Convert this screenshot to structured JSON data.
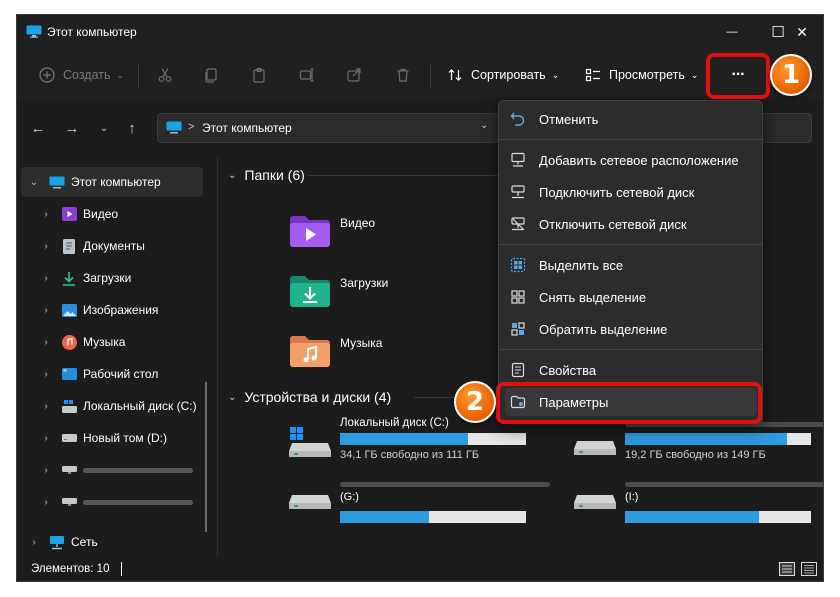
{
  "window": {
    "title": "Этот компьютер",
    "minimize_glyph": "—",
    "maximize_glyph": "☐",
    "close_glyph": "✕"
  },
  "toolbar": {
    "create_label": "Создать",
    "sort_label": "Сортировать",
    "view_label": "Просмотреть",
    "more_label": "···"
  },
  "address": {
    "path": "Этот компьютер",
    "separator": ">"
  },
  "sidebar": {
    "items": [
      {
        "label": "Этот компьютер",
        "icon": "monitor-icon"
      },
      {
        "label": "Видео",
        "icon": "video-folder-icon"
      },
      {
        "label": "Документы",
        "icon": "documents-icon"
      },
      {
        "label": "Загрузки",
        "icon": "downloads-icon"
      },
      {
        "label": "Изображения",
        "icon": "pictures-icon"
      },
      {
        "label": "Музыка",
        "icon": "music-icon"
      },
      {
        "label": "Рабочий стол",
        "icon": "desktop-icon"
      },
      {
        "label": "Локальный диск (C:)",
        "icon": "windows-drive-icon"
      },
      {
        "label": "Новый том (D:)",
        "icon": "drive-icon"
      },
      {
        "label": "",
        "icon": "network-drive-icon"
      },
      {
        "label": "",
        "icon": "network-drive-icon"
      },
      {
        "label": "Сеть",
        "icon": "network-icon"
      }
    ]
  },
  "content": {
    "folders_header": "Папки (6)",
    "folders": [
      {
        "label": "Видео",
        "icon": "video-folder-icon"
      },
      {
        "label": "Загрузки",
        "icon": "downloads-folder-icon"
      },
      {
        "label": "Музыка",
        "icon": "music-folder-icon"
      }
    ],
    "drives_header": "Устройства и диски (4)",
    "drives": [
      {
        "name": "Локальный диск (C:)",
        "sub": "34,1 ГБ свободно из 111 ГБ",
        "fill": 0.69
      },
      {
        "name": "",
        "sub": "19,2 ГБ свободно из 149 ГБ",
        "fill": 0.87
      },
      {
        "name": "",
        "sub": "(G:)",
        "fill": 0.48
      },
      {
        "name": "",
        "sub": "(I:)",
        "fill": 0.72
      }
    ]
  },
  "menu": {
    "items": [
      {
        "label": "Отменить",
        "icon": "undo-icon"
      },
      {
        "label": "Добавить сетевое расположение",
        "icon": "add-network-location-icon"
      },
      {
        "label": "Подключить сетевой диск",
        "icon": "map-network-drive-icon"
      },
      {
        "label": "Отключить сетевой диск",
        "icon": "disconnect-network-drive-icon"
      },
      {
        "label": "Выделить все",
        "icon": "select-all-icon"
      },
      {
        "label": "Снять выделение",
        "icon": "select-none-icon"
      },
      {
        "label": "Обратить выделение",
        "icon": "invert-selection-icon"
      },
      {
        "label": "Свойства",
        "icon": "properties-icon"
      },
      {
        "label": "Параметры",
        "icon": "options-icon"
      }
    ]
  },
  "status": {
    "items_count": "Элементов: 10"
  },
  "annotations": {
    "step1": "1",
    "step2": "2",
    "highlight_color": "#e01010",
    "badge_color": "#f07a10"
  },
  "colors": {
    "accent": "#2f9be0",
    "window_bg": "#1c1c1c",
    "menu_bg": "#2c2c2c"
  }
}
